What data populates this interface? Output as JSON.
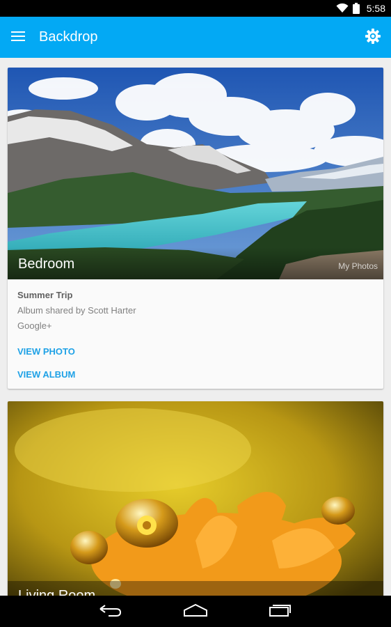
{
  "status_bar": {
    "time": "5:58",
    "icons": [
      "wifi-icon",
      "battery-icon"
    ]
  },
  "app_bar": {
    "title": "Backdrop",
    "menu_icon": "hamburger-menu-icon",
    "settings_icon": "gear-icon",
    "color": "#03a9f4"
  },
  "cards": [
    {
      "room": "Bedroom",
      "source": "My Photos",
      "title": "Summer Trip",
      "subtitle": "Album shared by Scott Harter",
      "service": "Google+",
      "actions": [
        "VIEW PHOTO",
        "VIEW ALBUM"
      ]
    },
    {
      "room": "Living Room"
    }
  ],
  "nav_bar": {
    "icons": [
      "back-icon",
      "home-icon",
      "recents-icon"
    ]
  },
  "accent_color": "#1ea1e6"
}
